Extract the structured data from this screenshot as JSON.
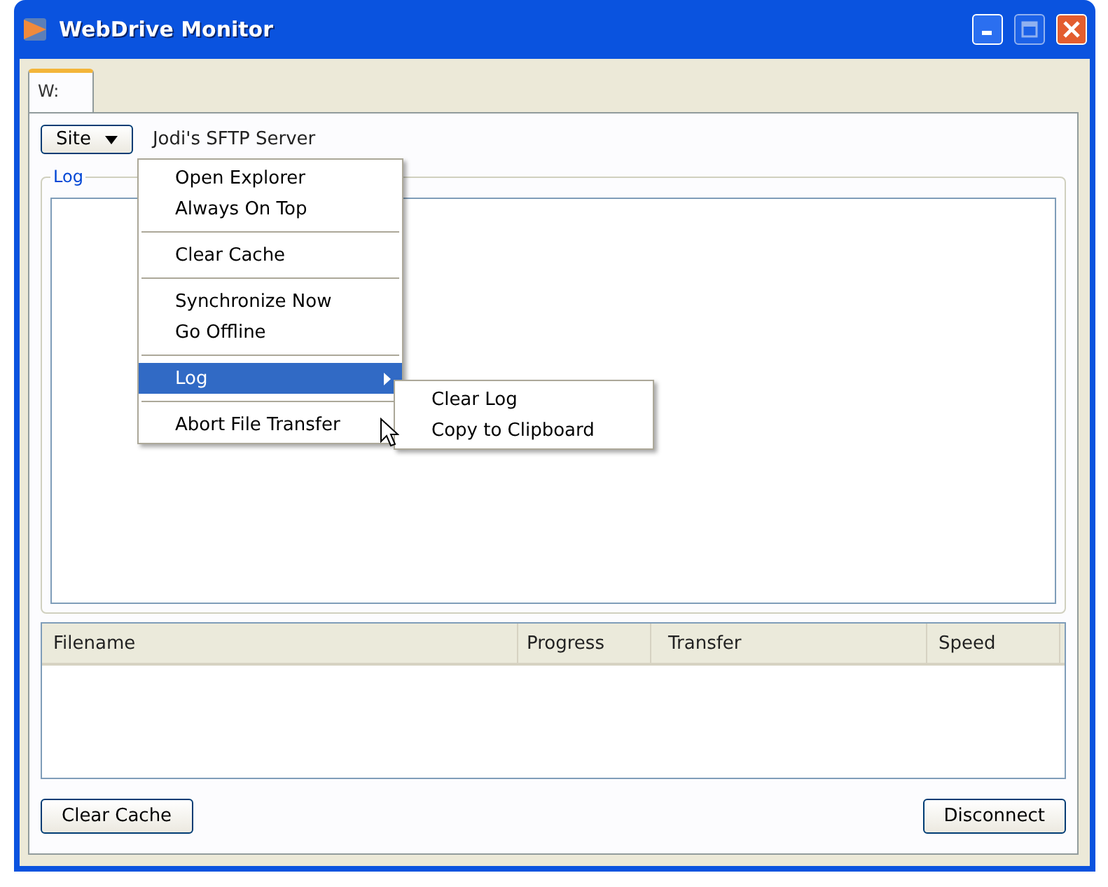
{
  "window": {
    "title": "WebDrive Monitor",
    "controls": [
      {
        "kind": "minimize",
        "disabled": false
      },
      {
        "kind": "maximize",
        "disabled": true
      },
      {
        "kind": "close",
        "disabled": false
      }
    ]
  },
  "tabs": [
    {
      "label": "W:",
      "selected": true
    }
  ],
  "site_button": {
    "label": "Site"
  },
  "server_label": "Jodi's SFTP Server",
  "log_group": {
    "title": "Log"
  },
  "table": {
    "columns": [
      "Filename",
      "Progress",
      "Transfer",
      "Speed"
    ]
  },
  "buttons": [
    "Clear Cache",
    "Disconnect"
  ],
  "context_menu": [
    {
      "kind": "item",
      "label": "Open Explorer",
      "selected": false
    },
    {
      "kind": "item",
      "label": "Always On Top",
      "selected": false
    },
    {
      "kind": "separator"
    },
    {
      "kind": "item",
      "label": "Clear Cache",
      "selected": false
    },
    {
      "kind": "separator"
    },
    {
      "kind": "item",
      "label": "Synchronize Now",
      "selected": false
    },
    {
      "kind": "item",
      "label": "Go Offline",
      "selected": false
    },
    {
      "kind": "separator"
    },
    {
      "kind": "submenu",
      "label": "Log",
      "selected": true,
      "children": [
        {
          "label": "Clear Log"
        },
        {
          "label": "Copy to Clipboard"
        }
      ]
    },
    {
      "kind": "separator"
    },
    {
      "kind": "item",
      "label": "Abort File Transfer",
      "selected": false
    }
  ]
}
